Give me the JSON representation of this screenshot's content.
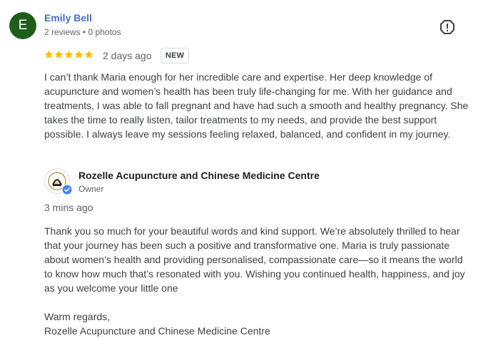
{
  "review": {
    "avatar_initial": "E",
    "avatar_color": "#1e5e1a",
    "reviewer_name": "Emily Bell",
    "reviewer_meta": "2 reviews • 0 photos",
    "rating": 5,
    "rating_max": 5,
    "star_color": "#fbbc04",
    "date": "2 days ago",
    "badge": "NEW",
    "text": "I can’t thank Maria enough for her incredible care and expertise. Her deep knowledge of acupuncture and women’s health has been truly life-changing for me. With her guidance and treatments, I was able to fall pregnant and have had such a smooth and healthy pregnancy. She takes the time to really listen, tailor treatments to my needs, and provide the best support possible. I always leave my sessions feeling relaxed, balanced, and confident in my journey.",
    "report_icon": "report-flag-icon"
  },
  "owner_reply": {
    "business_name": "Rozelle Acupuncture and Chinese Medicine Centre",
    "role": "Owner",
    "logo_icon": "business-logo-icon",
    "verified_icon": "verified-check-icon",
    "verified_color": "#4285f4",
    "date": "3 mins ago",
    "text": "Thank you so much for your beautiful words and kind support. We’re absolutely thrilled to hear that your journey has been such a positive and transformative one. Maria is truly passionate about women’s health and providing personalised, compassionate care—so it means the world to know how much that’s resonated with you. Wishing you continued health, happiness, and joy as you welcome your little one\n\nWarm regards,\nRozelle Acupuncture and Chinese Medicine Centre"
  }
}
